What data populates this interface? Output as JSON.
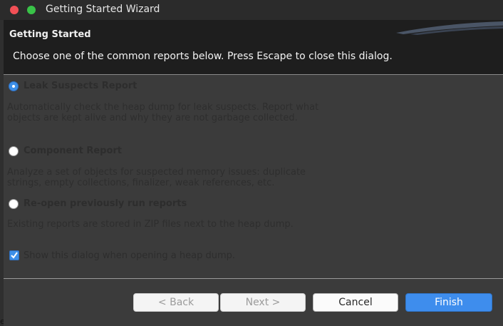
{
  "window": {
    "title": "Getting Started Wizard"
  },
  "banner": {
    "title": "Getting Started",
    "description": "Choose one of the common reports below. Press Escape to close this dialog."
  },
  "options": [
    {
      "label": "Leak Suspects Report",
      "description": "Automatically check the heap dump for leak suspects. Report what objects are kept alive and why they are not garbage collected.",
      "selected": true
    },
    {
      "label": "Component Report",
      "description": "Analyze a set of objects for suspected memory issues: duplicate strings, empty collections, finalizer, weak references, etc.",
      "selected": false
    },
    {
      "label": "Re-open previously run reports",
      "description": "Existing reports are stored in ZIP files next to the heap dump.",
      "selected": false
    }
  ],
  "show_dialog_checkbox": {
    "label": "Show this dialog when opening a heap dump.",
    "checked": true
  },
  "buttons": {
    "back": "< Back",
    "next": "Next >",
    "cancel": "Cancel",
    "finish": "Finish"
  },
  "colors": {
    "accent": "#3e8ded",
    "close": "#f25056",
    "maximize": "#39c348"
  },
  "edge_glyph": "e"
}
